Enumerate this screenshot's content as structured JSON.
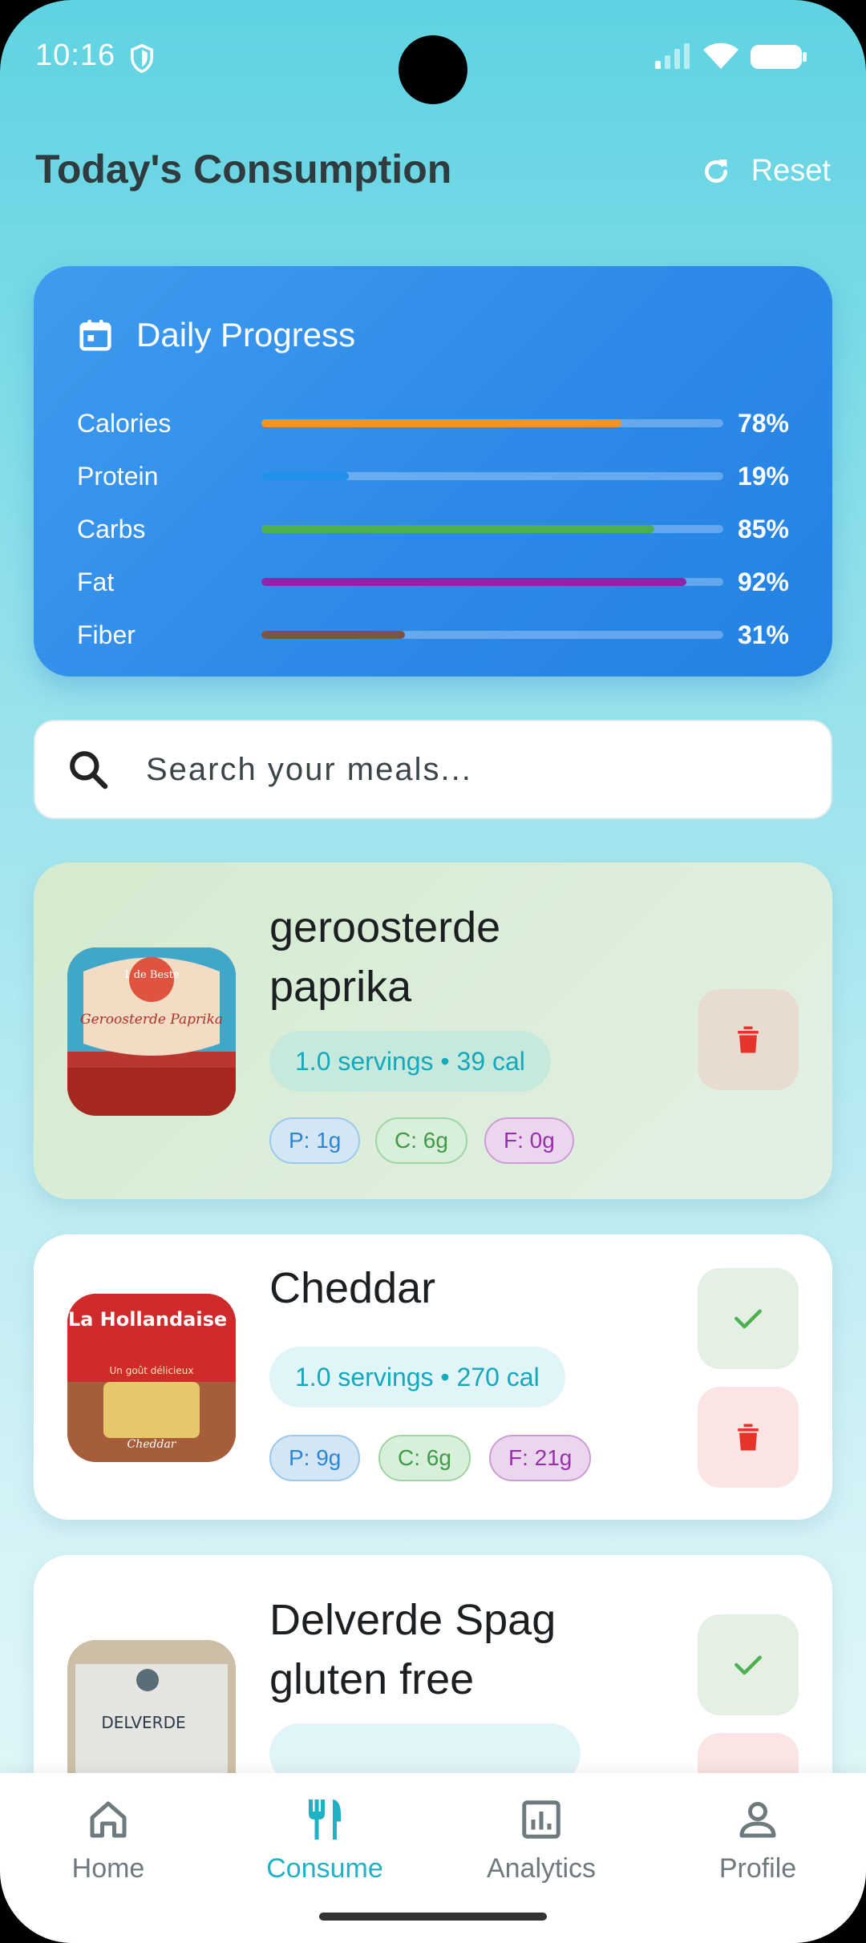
{
  "status_bar": {
    "time": "10:16"
  },
  "header": {
    "title": "Today's Consumption",
    "reset_label": "Reset"
  },
  "daily_progress": {
    "title": "Daily Progress",
    "metrics": [
      {
        "label": "Calories",
        "percent_text": "78%",
        "value": 0.78,
        "color": "#f39321"
      },
      {
        "label": "Protein",
        "percent_text": "19%",
        "value": 0.19,
        "color": "#2191ee"
      },
      {
        "label": "Carbs",
        "percent_text": "85%",
        "value": 0.85,
        "color": "#4caf50"
      },
      {
        "label": "Fat",
        "percent_text": "92%",
        "value": 0.92,
        "color": "#8e24aa"
      },
      {
        "label": "Fiber",
        "percent_text": "31%",
        "value": 0.31,
        "color": "#795548"
      }
    ]
  },
  "search": {
    "placeholder": "Search your meals..."
  },
  "meals": [
    {
      "name_line1": "geroosterde",
      "name_line2": "paprika",
      "servings": "1.0 servings • 39 cal",
      "protein": "P: 1g",
      "carbs": "C: 6g",
      "fat": "F: 0g",
      "thumb_text_1": "1 de Beste",
      "thumb_text_2": "Geroosterde Paprika"
    },
    {
      "name_line1": "Cheddar",
      "servings": "1.0 servings • 270 cal",
      "protein": "P: 9g",
      "carbs": "C: 6g",
      "fat": "F: 21g",
      "thumb_text_1": "La Hollandaise",
      "thumb_text_2": "Un goût délicieux",
      "thumb_text_3": "Cheddar"
    },
    {
      "name_line1": "Delverde Spag",
      "name_line2": "gluten free",
      "thumb_text_1": "DELVERDE"
    }
  ],
  "nav": {
    "items": [
      {
        "label": "Home",
        "icon": "home-icon"
      },
      {
        "label": "Consume",
        "icon": "fork-knife-icon"
      },
      {
        "label": "Analytics",
        "icon": "analytics-icon"
      },
      {
        "label": "Profile",
        "icon": "person-icon"
      }
    ],
    "active": "Consume",
    "accent": "#1fb1c6"
  }
}
